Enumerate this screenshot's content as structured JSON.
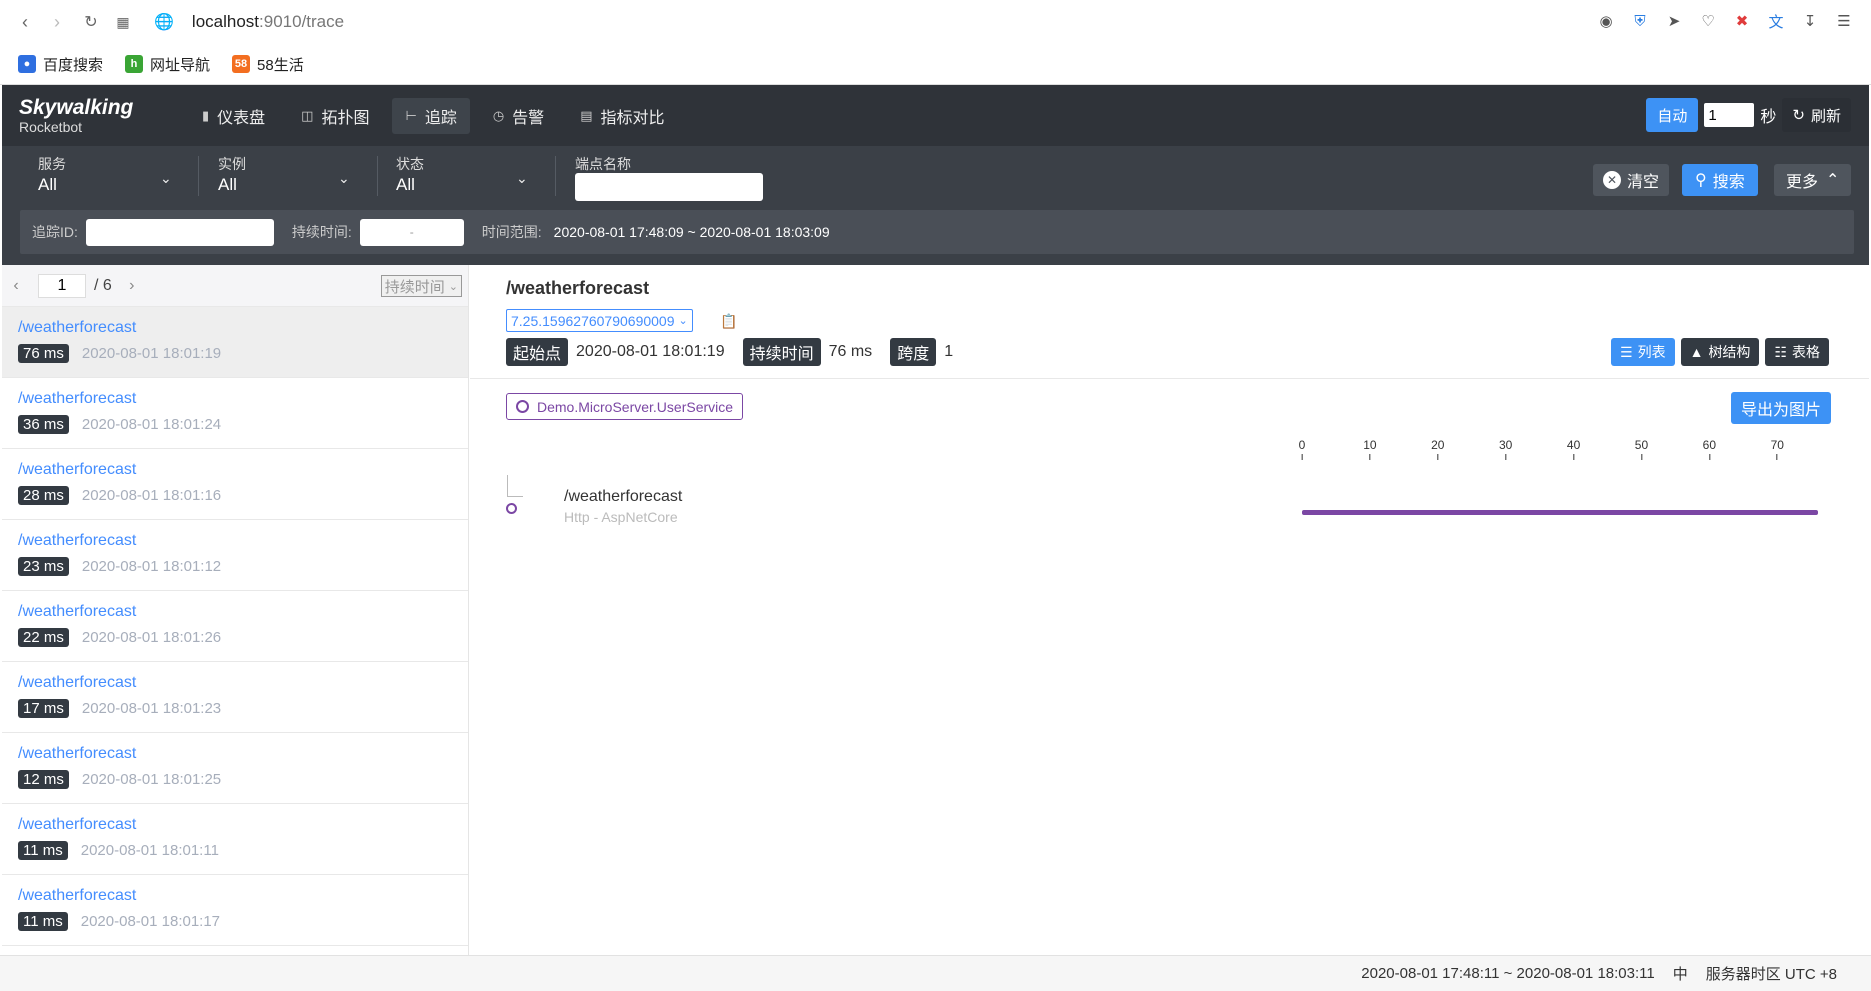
{
  "browser": {
    "url_host": "localhost",
    "url_path": ":9010/trace",
    "bookmarks": [
      {
        "label": "百度搜索",
        "icon": "paw-icon",
        "color": "#2f6fe0"
      },
      {
        "label": "网址导航",
        "icon": "hao-icon",
        "color": "#3aa535"
      },
      {
        "label": "58生活",
        "icon": "58-icon",
        "color": "#f36e20"
      }
    ]
  },
  "header": {
    "logo_main": "Skywalking",
    "logo_sub": "Rocketbot",
    "nav": [
      {
        "label": "仪表盘",
        "icon": "dashboard-icon"
      },
      {
        "label": "拓扑图",
        "icon": "topology-icon"
      },
      {
        "label": "追踪",
        "icon": "trace-icon",
        "active": true
      },
      {
        "label": "告警",
        "icon": "alarm-icon"
      },
      {
        "label": "指标对比",
        "icon": "metrics-icon"
      }
    ],
    "auto_label": "自动",
    "interval_value": "1",
    "seconds_label": "秒",
    "refresh_label": "刷新"
  },
  "filters": {
    "service_label": "服务",
    "service_value": "All",
    "instance_label": "实例",
    "instance_value": "All",
    "status_label": "状态",
    "status_value": "All",
    "endpoint_label": "端点名称",
    "clear_label": "清空",
    "search_label": "搜索",
    "more_label": "更多",
    "trace_id_label": "追踪ID:",
    "duration_label": "持续时间:",
    "duration_placeholder": "-",
    "time_range_label": "时间范围:",
    "time_range_value": "2020-08-01 17:48:09 ~ 2020-08-01 18:03:09"
  },
  "list": {
    "page": "1",
    "total": "/ 6",
    "sort_label": "持续时间",
    "traces": [
      {
        "name": "/weatherforecast",
        "duration": "76 ms",
        "time": "2020-08-01 18:01:19"
      },
      {
        "name": "/weatherforecast",
        "duration": "36 ms",
        "time": "2020-08-01 18:01:24"
      },
      {
        "name": "/weatherforecast",
        "duration": "28 ms",
        "time": "2020-08-01 18:01:16"
      },
      {
        "name": "/weatherforecast",
        "duration": "23 ms",
        "time": "2020-08-01 18:01:12"
      },
      {
        "name": "/weatherforecast",
        "duration": "22 ms",
        "time": "2020-08-01 18:01:26"
      },
      {
        "name": "/weatherforecast",
        "duration": "17 ms",
        "time": "2020-08-01 18:01:23"
      },
      {
        "name": "/weatherforecast",
        "duration": "12 ms",
        "time": "2020-08-01 18:01:25"
      },
      {
        "name": "/weatherforecast",
        "duration": "11 ms",
        "time": "2020-08-01 18:01:11"
      },
      {
        "name": "/weatherforecast",
        "duration": "11 ms",
        "time": "2020-08-01 18:01:17"
      }
    ]
  },
  "detail": {
    "title": "/weatherforecast",
    "trace_id": "7.25.15962760790690009",
    "start_label": "起始点",
    "start_value": "2020-08-01 18:01:19",
    "duration_label": "持续时间",
    "duration_value": "76 ms",
    "span_label": "跨度",
    "span_value": "1",
    "view_list": "列表",
    "view_tree": "树结构",
    "view_table": "表格",
    "service": "Demo.MicroServer.UserService",
    "export_label": "导出为图片",
    "axis_ticks": [
      "0",
      "10",
      "20",
      "30",
      "40",
      "50",
      "60",
      "70"
    ],
    "span": {
      "name": "/weatherforecast",
      "component": "Http - AspNetCore",
      "start_ms": 0,
      "duration_ms": 76
    }
  },
  "footer": {
    "range": "2020-08-01 17:48:11 ~ 2020-08-01 18:03:11",
    "lang": "中",
    "timezone": "服务器时区 UTC +8"
  }
}
